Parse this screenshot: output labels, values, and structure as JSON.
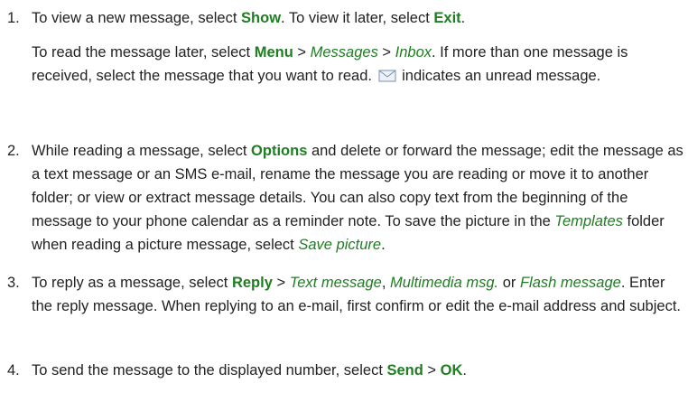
{
  "items": [
    {
      "number": "1.",
      "p1": {
        "a": "To view a new message, select ",
        "b": "Show",
        "c": ". To view it later, select ",
        "d": "Exit",
        "e": "."
      },
      "p2": {
        "a": "To read the message later, select ",
        "b": "Menu",
        "c": " > ",
        "d": "Messages",
        "e": " > ",
        "f": "Inbox",
        "g": ". If more than one message is received, select the message that you want to read. ",
        "h": " indicates an unread message."
      }
    },
    {
      "number": "2.",
      "a": "While reading a message, select ",
      "b": "Options",
      "c": " and delete or forward the message; edit the message as a text message or an SMS e-mail, rename the message you are reading or move it to another folder; or view or extract message details. You can also copy text from the beginning of the message to your phone calendar as a reminder note. To save the picture in the ",
      "d": "Templates",
      "e": " folder when reading a picture message, select ",
      "f": "Save picture",
      "g": "."
    },
    {
      "number": "3.",
      "a": "To reply as a message, select ",
      "b": "Reply",
      "c": " > ",
      "d": "Text message",
      "e": ", ",
      "f": "Multimedia msg.",
      "g": " or ",
      "h": "Flash message",
      "i": ". Enter the reply message. When replying to an e-mail, first confirm or edit the e-mail address and subject."
    },
    {
      "number": "4.",
      "a": "To send the message to the displayed number, select ",
      "b": "Send",
      "c": " > ",
      "d": "OK",
      "e": "."
    }
  ],
  "icons": {
    "unread": "envelope-icon"
  },
  "colors": {
    "accent": "#1f7d22",
    "text": "#222222"
  }
}
